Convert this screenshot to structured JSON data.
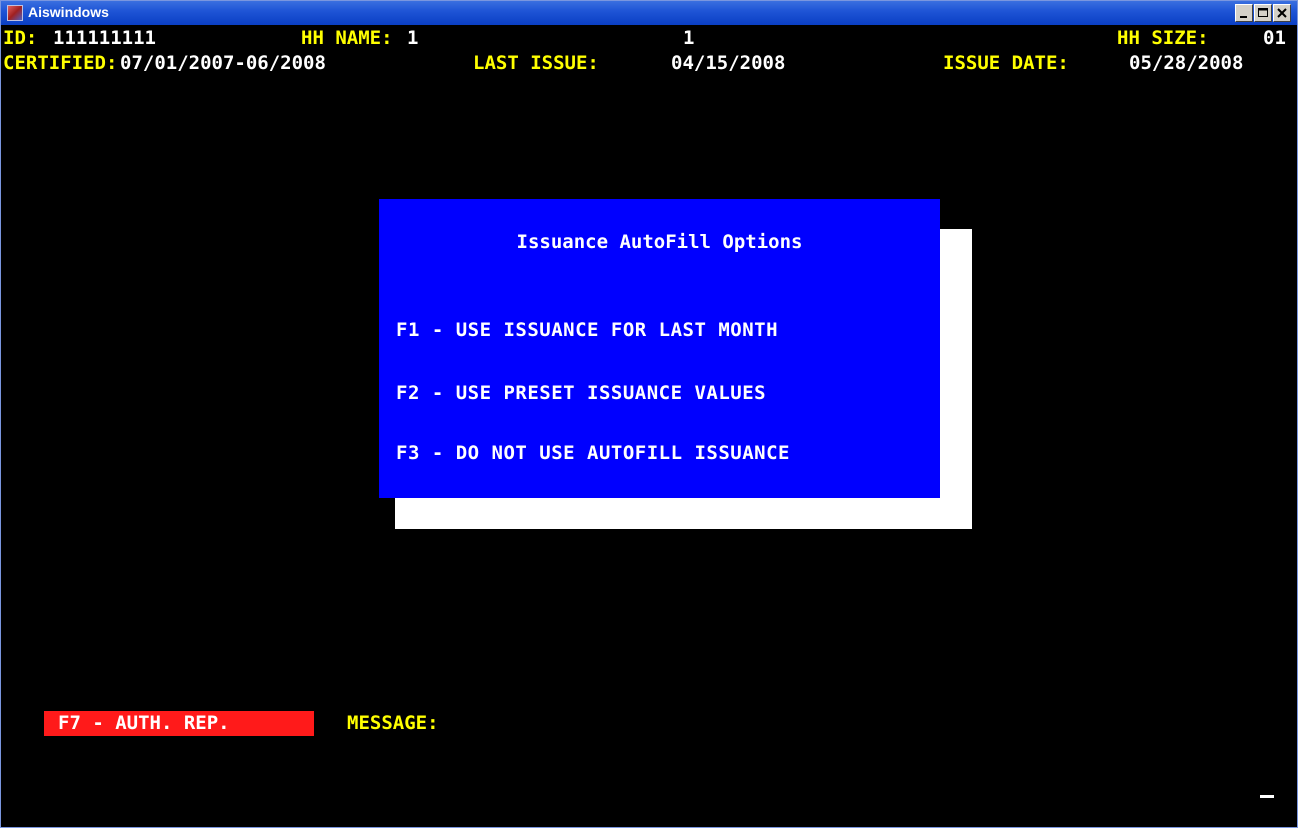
{
  "window": {
    "title": "Aiswindows",
    "icon": "app-icon"
  },
  "header": {
    "id_label": "ID:",
    "id_value": "111111111",
    "hh_name_label": "HH NAME:",
    "hh_name_value": "1",
    "hh_name_value2": "1",
    "hh_size_label": "HH SIZE:",
    "hh_size_value": "01",
    "certified_label": "CERTIFIED:",
    "certified_value": "07/01/2007-06/2008",
    "last_issue_label": "LAST ISSUE:",
    "last_issue_value": "04/15/2008",
    "issue_date_label": "ISSUE DATE:",
    "issue_date_value": "05/28/2008"
  },
  "dialog": {
    "title": "Issuance AutoFill Options",
    "options": [
      "F1 - USE ISSUANCE FOR LAST MONTH",
      "F2 - USE PRESET ISSUANCE VALUES",
      "F3 - DO NOT USE AUTOFILL ISSUANCE"
    ]
  },
  "footer": {
    "f7_label": "F7 - AUTH. REP.",
    "message_label": "MESSAGE:"
  },
  "colors": {
    "screen_bg": "#000000",
    "text_yellow": "#ffff00",
    "dialog_bg": "#0000ff",
    "f7_bg": "#ff1a1a"
  }
}
